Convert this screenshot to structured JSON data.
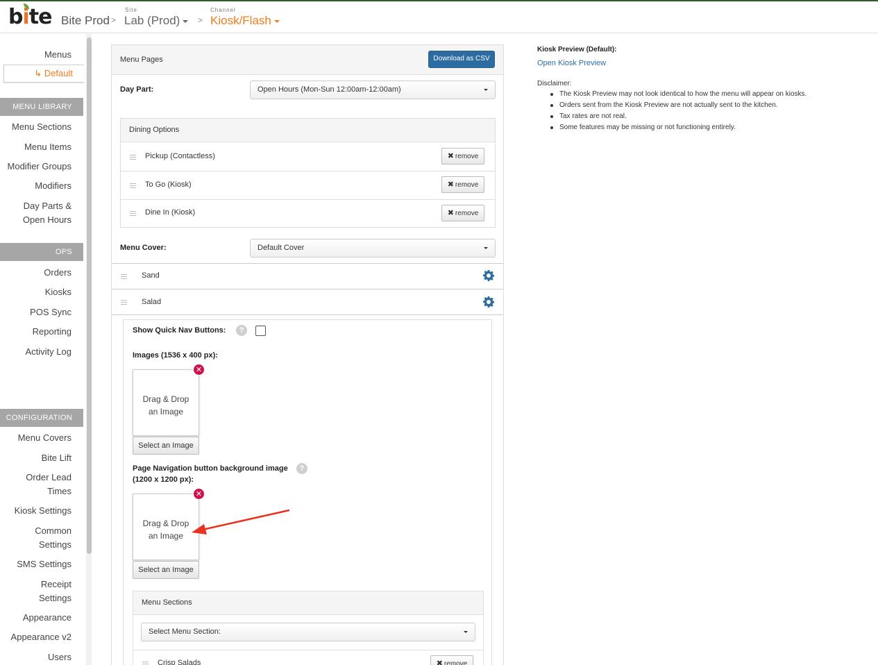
{
  "header": {
    "logo": "bite",
    "brand": "Bite Prod",
    "site_label": "Site",
    "site_value": "Lab (Prod)",
    "channel_label": "Channel",
    "channel_value": "Kiosk/Flash",
    "separator": ">"
  },
  "sidebar": {
    "menus": "Menus",
    "default": "↳ Default",
    "menu_library_header": "MENU LIBRARY",
    "menu_library": [
      "Menu Sections",
      "Menu Items",
      "Modifier Groups",
      "Modifiers",
      "Day Parts &",
      "Open Hours"
    ],
    "ops_header": "OPS",
    "ops": [
      "Orders",
      "Kiosks",
      "POS Sync",
      "Reporting",
      "Activity Log"
    ],
    "config_header": "CONFIGURATION",
    "config": [
      "Menu Covers",
      "Bite Lift",
      "Order Lead",
      "Times",
      "Kiosk Settings",
      "Common",
      "Settings",
      "SMS Settings",
      "Receipt",
      "Settings",
      "Appearance",
      "Appearance v2",
      "Users"
    ]
  },
  "main": {
    "panel_title": "Menu Pages",
    "download_csv": "Download as CSV",
    "day_part_label": "Day Part:",
    "day_part_value": "Open Hours (Mon-Sun 12:00am-12:00am)",
    "dining_options_title": "Dining Options",
    "dining_options": [
      "Pickup (Contactless)",
      "To Go (Kiosk)",
      "Dine In (Kiosk)"
    ],
    "remove_label": "remove",
    "menu_cover_label": "Menu Cover:",
    "menu_cover_value": "Default Cover",
    "pages": [
      "Sand",
      "Salad"
    ],
    "show_quick_nav": "Show Quick Nav Buttons:",
    "images_label": "Images (1536 x 400 px):",
    "drag_drop_line1": "Drag & Drop",
    "drag_drop_line2": "an Image",
    "select_image": "Select an Image",
    "page_nav_label_line1": "Page Navigation button background image",
    "page_nav_label_line2": "(1200 x 1200 px):",
    "menu_sections_title": "Menu Sections",
    "select_menu_section": "Select Menu Section:",
    "section_item": "Crisp Salads"
  },
  "preview": {
    "title": "Kiosk Preview (Default):",
    "link": "Open Kiosk Preview",
    "disclaimer": "Disclaimer:",
    "bullets": [
      "The Kiosk Preview may not look identical to how the menu will appear on kiosks.",
      "Orders sent from the Kiosk Preview are not actually sent to the kitchen.",
      "Tax rates are not real.",
      "Some features may be missing or not functioning entirely."
    ]
  },
  "colors": {
    "accent": "#ef7d1a",
    "primary": "#2d6ca2",
    "danger": "#d0124b",
    "arrow": "#e8321f"
  },
  "icons": [
    "gear-icon",
    "help-icon",
    "drag-handle-icon",
    "close-icon",
    "caret-down-icon",
    "remove-icon",
    "arrow-annotation"
  ]
}
